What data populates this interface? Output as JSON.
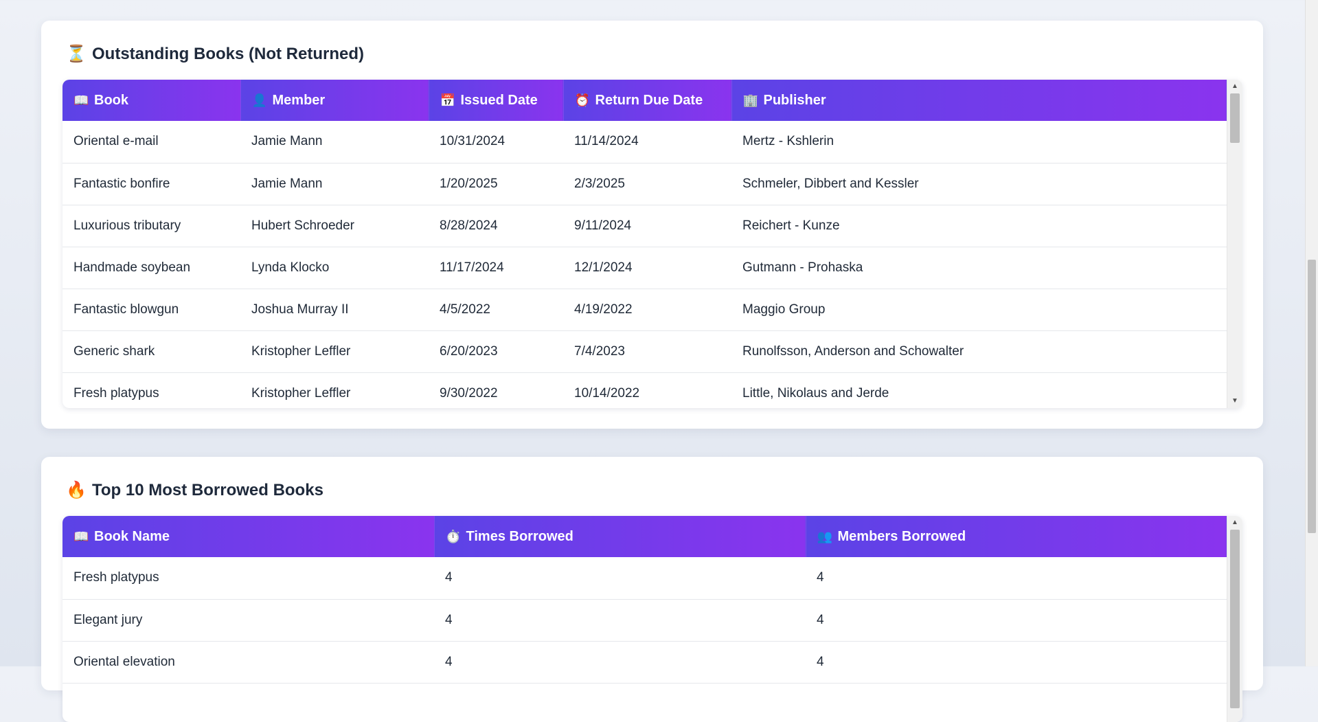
{
  "outstanding": {
    "title_icon": "⏳",
    "title": "Outstanding Books (Not Returned)",
    "columns": [
      {
        "icon": "📖",
        "label": "Book"
      },
      {
        "icon": "👤",
        "label": "Member"
      },
      {
        "icon": "📅",
        "label": "Issued Date"
      },
      {
        "icon": "⏰",
        "label": "Return Due Date"
      },
      {
        "icon": "🏢",
        "label": "Publisher"
      }
    ],
    "rows": [
      [
        "Oriental e-mail",
        "Jamie Mann",
        "10/31/2024",
        "11/14/2024",
        "Mertz - Kshlerin"
      ],
      [
        "Fantastic bonfire",
        "Jamie Mann",
        "1/20/2025",
        "2/3/2025",
        "Schmeler, Dibbert and Kessler"
      ],
      [
        "Luxurious tributary",
        "Hubert Schroeder",
        "8/28/2024",
        "9/11/2024",
        "Reichert - Kunze"
      ],
      [
        "Handmade soybean",
        "Lynda Klocko",
        "11/17/2024",
        "12/1/2024",
        "Gutmann - Prohaska"
      ],
      [
        "Fantastic blowgun",
        "Joshua Murray II",
        "4/5/2022",
        "4/19/2022",
        "Maggio Group"
      ],
      [
        "Generic shark",
        "Kristopher Leffler",
        "6/20/2023",
        "7/4/2023",
        "Runolfsson, Anderson and Schowalter"
      ],
      [
        "Fresh platypus",
        "Kristopher Leffler",
        "9/30/2022",
        "10/14/2022",
        "Little, Nikolaus and Jerde"
      ]
    ]
  },
  "top_borrowed": {
    "title_icon": "🔥",
    "title": "Top 10 Most Borrowed Books",
    "columns": [
      {
        "icon": "📖",
        "label": "Book Name"
      },
      {
        "icon": "⏱️",
        "label": "Times Borrowed"
      },
      {
        "icon": "👥",
        "label": "Members Borrowed"
      }
    ],
    "rows": [
      [
        "Fresh platypus",
        "4",
        "4"
      ],
      [
        "Elegant jury",
        "4",
        "4"
      ],
      [
        "Oriental elevation",
        "4",
        "4"
      ]
    ]
  },
  "scrollbar": {
    "up_arrow": "▲",
    "down_arrow": "▼"
  }
}
